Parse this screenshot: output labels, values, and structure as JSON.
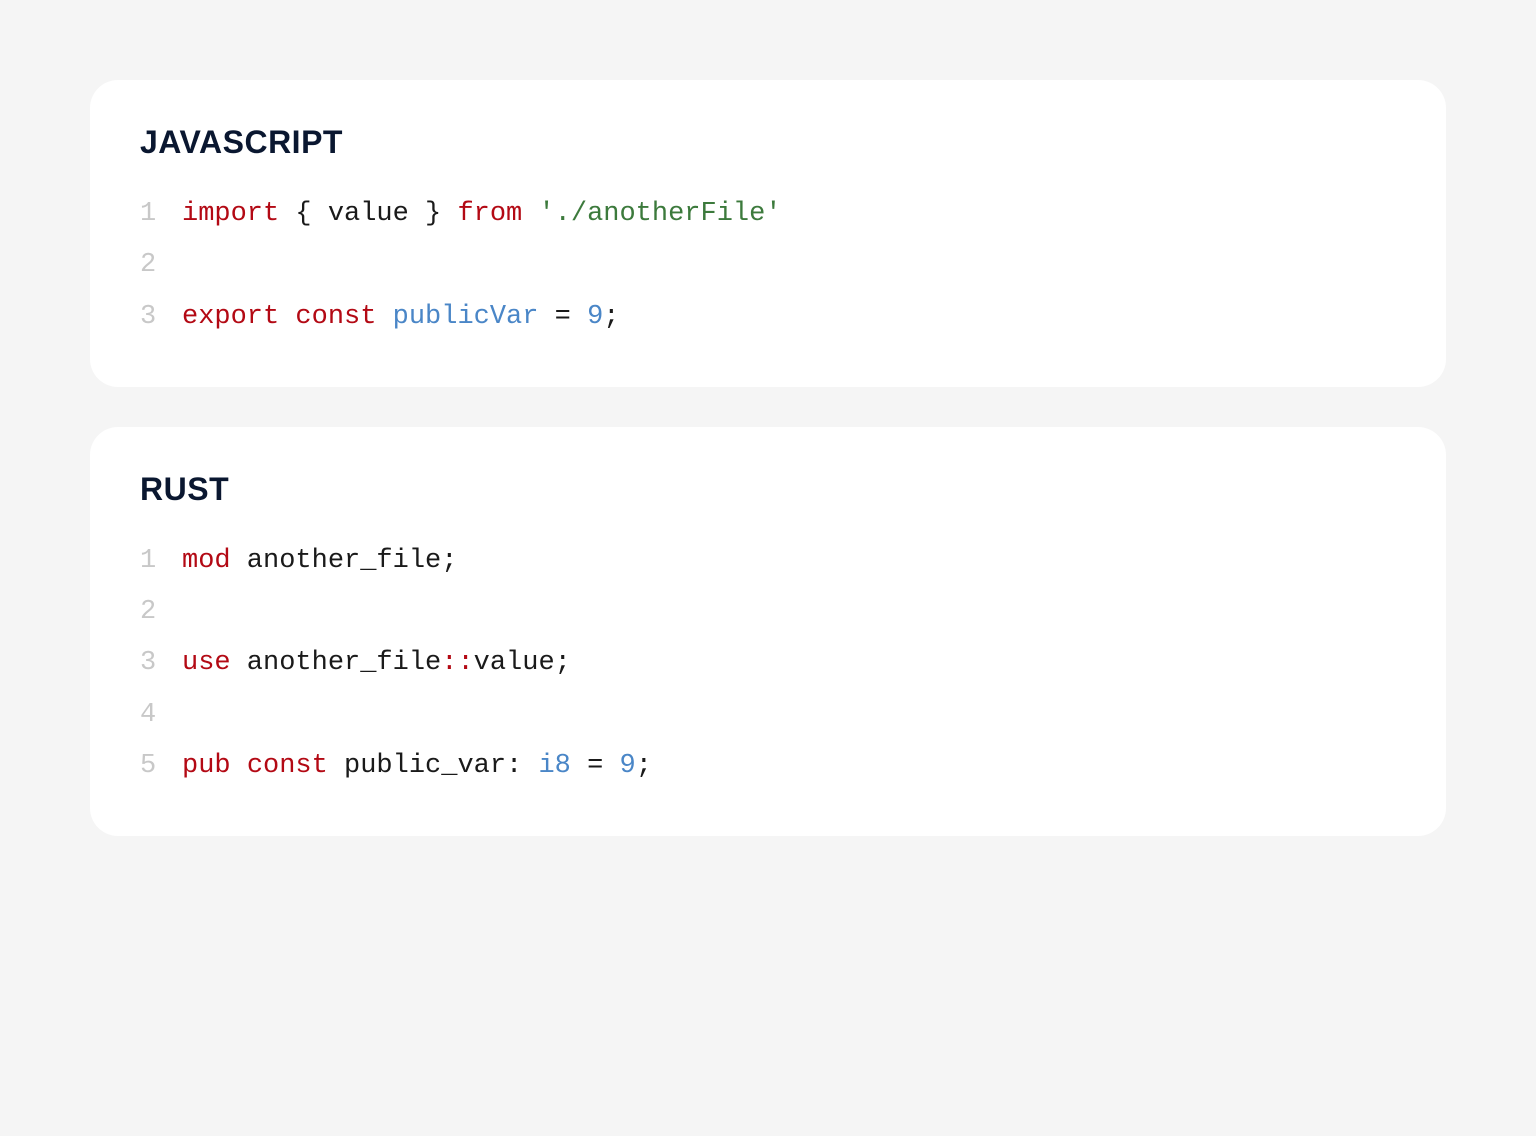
{
  "blocks": [
    {
      "title": "JAVASCRIPT",
      "lines": [
        {
          "num": "1",
          "tokens": [
            {
              "cls": "tk-keyword",
              "text": "import"
            },
            {
              "cls": "tk-default",
              "text": " { value } "
            },
            {
              "cls": "tk-keyword",
              "text": "from"
            },
            {
              "cls": "tk-default",
              "text": " "
            },
            {
              "cls": "tk-string",
              "text": "'./anotherFile'"
            }
          ]
        },
        {
          "num": "2",
          "tokens": []
        },
        {
          "num": "3",
          "tokens": [
            {
              "cls": "tk-keyword",
              "text": "export"
            },
            {
              "cls": "tk-default",
              "text": " "
            },
            {
              "cls": "tk-keyword",
              "text": "const"
            },
            {
              "cls": "tk-default",
              "text": " "
            },
            {
              "cls": "tk-ident",
              "text": "publicVar"
            },
            {
              "cls": "tk-default",
              "text": " = "
            },
            {
              "cls": "tk-number",
              "text": "9"
            },
            {
              "cls": "tk-punct",
              "text": ";"
            }
          ]
        }
      ]
    },
    {
      "title": "RUST",
      "lines": [
        {
          "num": "1",
          "tokens": [
            {
              "cls": "tk-keyword",
              "text": "mod"
            },
            {
              "cls": "tk-default",
              "text": " another_file"
            },
            {
              "cls": "tk-punct",
              "text": ";"
            }
          ]
        },
        {
          "num": "2",
          "tokens": []
        },
        {
          "num": "3",
          "tokens": [
            {
              "cls": "tk-keyword",
              "text": "use"
            },
            {
              "cls": "tk-default",
              "text": " another_file"
            },
            {
              "cls": "tk-op",
              "text": "::"
            },
            {
              "cls": "tk-default",
              "text": "value"
            },
            {
              "cls": "tk-punct",
              "text": ";"
            }
          ]
        },
        {
          "num": "4",
          "tokens": []
        },
        {
          "num": "5",
          "tokens": [
            {
              "cls": "tk-keyword",
              "text": "pub"
            },
            {
              "cls": "tk-default",
              "text": " "
            },
            {
              "cls": "tk-keyword",
              "text": "const"
            },
            {
              "cls": "tk-default",
              "text": " public_var: "
            },
            {
              "cls": "tk-type",
              "text": "i8"
            },
            {
              "cls": "tk-default",
              "text": " = "
            },
            {
              "cls": "tk-number",
              "text": "9"
            },
            {
              "cls": "tk-punct",
              "text": ";"
            }
          ]
        }
      ]
    }
  ]
}
